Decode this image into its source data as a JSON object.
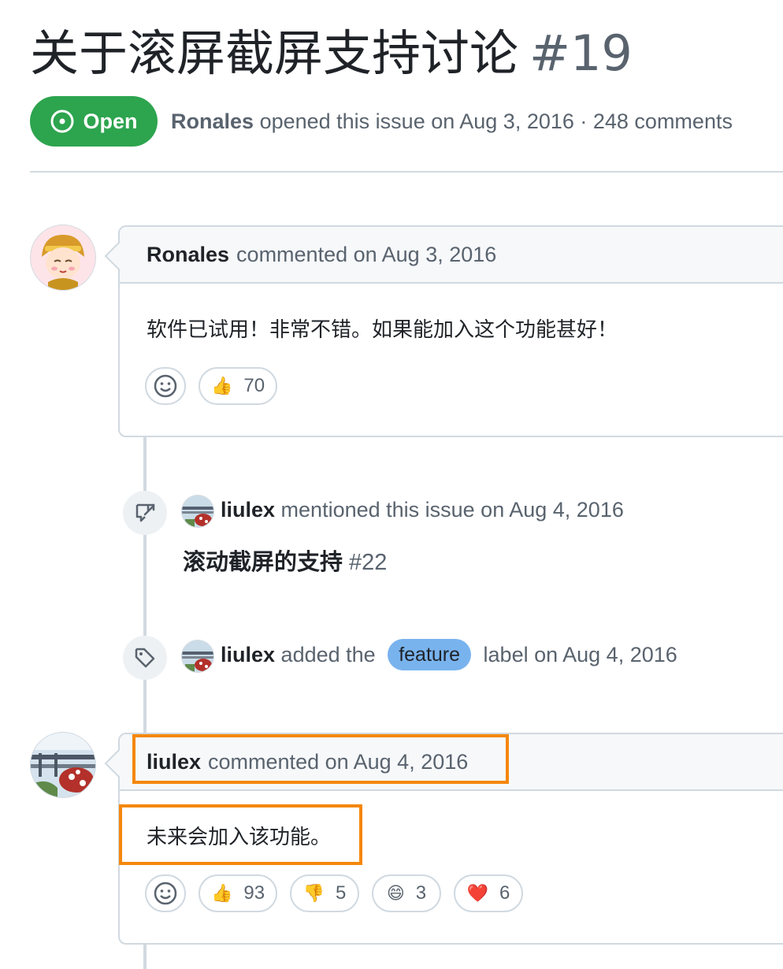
{
  "issue": {
    "title": "关于滚屏截屏支持讨论",
    "number": "#19",
    "state": "Open",
    "author": "Ronales",
    "opened_text": "opened this issue on Aug 3, 2016 · 248 comments"
  },
  "comment1": {
    "author": "Ronales",
    "meta": "commented on Aug 3, 2016",
    "body": "软件已试用！非常不错。如果能加入这个功能甚好！",
    "reactions": [
      {
        "emoji": "👍",
        "count": "70"
      }
    ]
  },
  "event_mention": {
    "actor": "liulex",
    "text": "mentioned this issue on Aug 4, 2016",
    "ref_title": "滚动截屏的支持",
    "ref_number": "#22"
  },
  "event_label": {
    "actor": "liulex",
    "text_before": "added the",
    "label": "feature",
    "text_after": "label on Aug 4, 2016",
    "label_color": "#79b3ee"
  },
  "comment2": {
    "author": "liulex",
    "meta": "commented on Aug 4, 2016",
    "body": "未来会加入该功能。",
    "reactions": [
      {
        "emoji": "👍",
        "count": "93"
      },
      {
        "emoji": "👎",
        "count": "5"
      },
      {
        "emoji": "😄",
        "count": "3"
      },
      {
        "emoji": "❤️",
        "count": "6"
      }
    ]
  },
  "colors": {
    "open_green": "#2da44e",
    "highlight_orange": "#f5870c",
    "border": "#d1d9e0",
    "muted_text": "#59636e"
  }
}
